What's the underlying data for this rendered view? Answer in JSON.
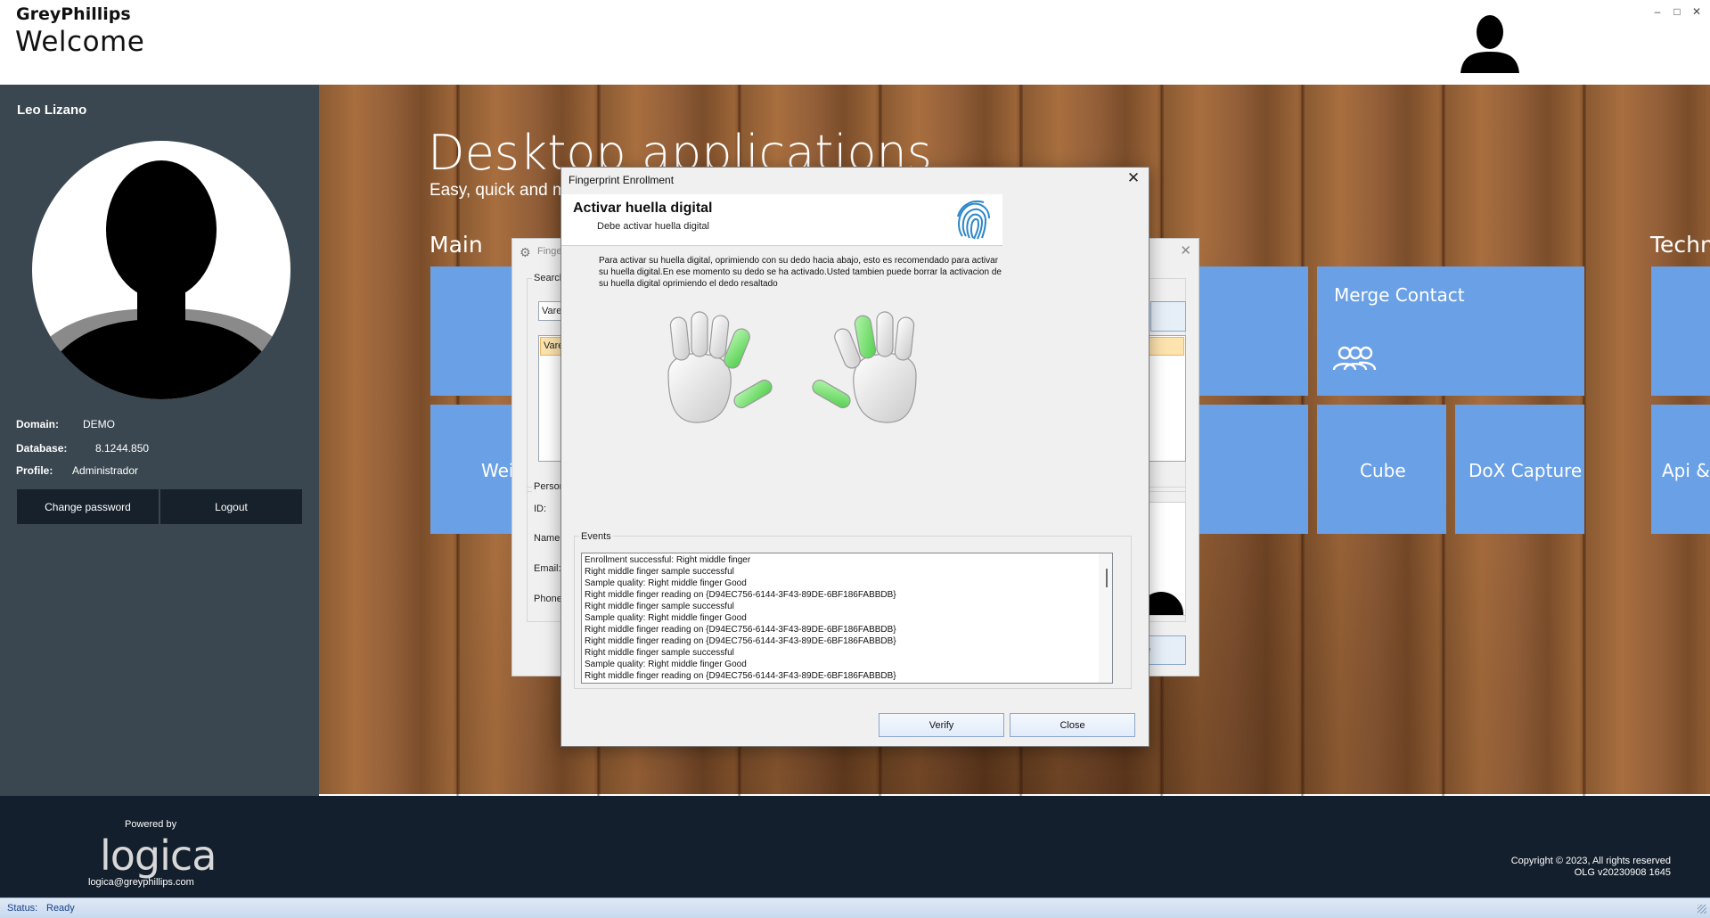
{
  "app": {
    "company": "GreyPhillips",
    "page_title": "Welcome"
  },
  "window_controls": {
    "minimize": "–",
    "maximize": "□",
    "close": "✕"
  },
  "sidebar": {
    "user_name": "Leo Lizano",
    "domain_label": "Domain:",
    "domain_value": "DEMO",
    "database_label": "Database:",
    "database_value": "8.1244.850",
    "profile_label": "Profile:",
    "profile_value": "Administrador",
    "change_password": "Change password",
    "logout": "Logout"
  },
  "main": {
    "title": "Desktop applications",
    "subtitle": "Easy, quick and m",
    "group_main": "Main",
    "group_tech": "Techn",
    "tiles": {
      "merge_contact": "Merge Contact",
      "cube": "Cube",
      "dox_capture": "DoX Capture",
      "api": "Api &",
      "wei": "Wei"
    }
  },
  "bg_window": {
    "title": "Finge",
    "search_label": "Search",
    "search_value": "Vare",
    "selected_row": "Vare",
    "person_label": "Person",
    "id_label": "ID:",
    "name_label": "Name:",
    "email_label": "Email:",
    "phone_label": "Phone",
    "button_partial": "e"
  },
  "dialog": {
    "title": "Fingerprint Enrollment",
    "close_glyph": "✕",
    "banner_title": "Activar huella digital",
    "banner_subtitle": "Debe activar huella digital",
    "instructions": "Para activar su huella digital, oprimiendo con su dedo hacia abajo, esto es recomendado para activar su huella digital.En ese momento su dedo se ha activado.Usted tambien puede borrar la activacion de su huella digital oprimiendo el dedo resaltado",
    "events_label": "Events",
    "events": [
      "Enrollment successful: Right middle finger",
      "Right middle finger sample successful",
      "Sample quality: Right middle finger Good",
      "Right middle finger reading on {D94EC756-6144-3F43-89DE-6BF186FABBDB}",
      "Right middle finger sample successful",
      "Sample quality: Right middle finger Good",
      "Right middle finger reading on {D94EC756-6144-3F43-89DE-6BF186FABBDB}",
      "Right middle finger reading on {D94EC756-6144-3F43-89DE-6BF186FABBDB}",
      "Right middle finger sample successful",
      "Sample quality: Right middle finger Good",
      "Right middle finger reading on {D94EC756-6144-3F43-89DE-6BF186FABBDB}"
    ],
    "verify_button": "Verify",
    "close_button": "Close"
  },
  "footer": {
    "powered_by": "Powered by",
    "logo": "logica",
    "email": "logica@greyphillips.com",
    "copyright": "Copyright © 2023, All rights reserved",
    "version": "OLG v20230908 1645"
  },
  "status": {
    "label": "Status:",
    "value": "Ready"
  },
  "colors": {
    "tile": "#6aa0e6",
    "sidebar": "#3a4750",
    "footer": "#131f2c",
    "finger_active": "#7ee07a"
  }
}
